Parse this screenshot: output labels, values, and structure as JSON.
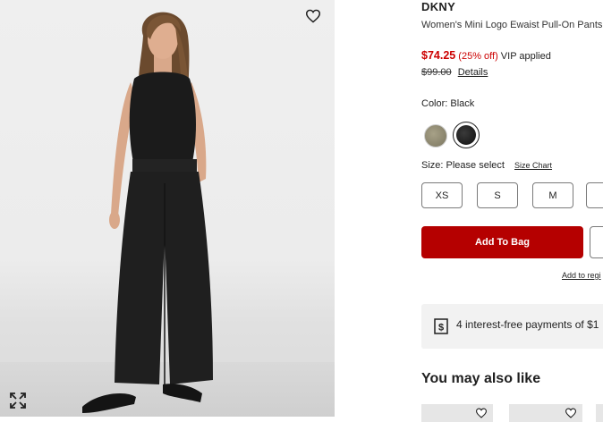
{
  "product": {
    "brand": "DKNY",
    "title": "Women's Mini Logo Ewaist Pull-On Pants",
    "sale_price": "$74.25",
    "discount": "(25% off)",
    "vip_label": "VIP applied",
    "original_price": "$99.00",
    "details_link": "Details"
  },
  "color": {
    "label": "Color: Black",
    "swatches": [
      "Olive",
      "Black"
    ],
    "selected": "Black"
  },
  "size": {
    "label": "Size: Please select",
    "chart_link": "Size Chart",
    "options": [
      "XS",
      "S",
      "M",
      ""
    ]
  },
  "actions": {
    "add_to_bag": "Add To Bag",
    "registry_link": "Add to regi"
  },
  "payments": {
    "text": "4 interest-free payments of $1"
  },
  "recommendations": {
    "heading": "You may also like"
  },
  "icons": {
    "wishlist": "heart-icon",
    "expand": "expand-icon",
    "payment": "dollar-receipt-icon"
  },
  "colors": {
    "sale_red": "#cc0000",
    "add_to_bag_bg": "#b50000",
    "payments_bg": "#f2f2f2"
  }
}
